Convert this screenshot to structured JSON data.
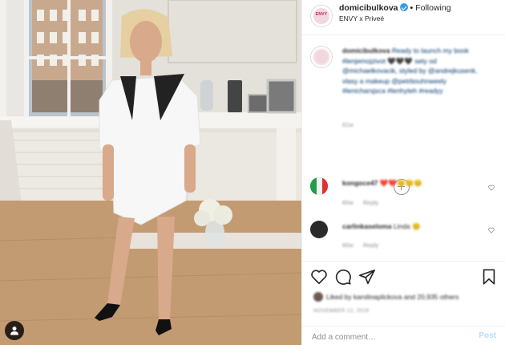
{
  "post": {
    "author": "domicibulkova",
    "follow_label": "Following",
    "location": "ENVY x Priveé",
    "avatar_text": "ENVY"
  },
  "caption": {
    "user": "domicibulkova",
    "text": "Ready to launch my book #lenjemojzivot 🖤🖤🖤 sety od @michaelkovacik, styled by @andrejkusenk, vlasy a makeup @petrbouhnweely #lenicharsjsca #lenhyteh #readyy",
    "time": "61w"
  },
  "comments": [
    {
      "user": "kongoce47",
      "text": "❤️❤️😊😊😊",
      "time": "60w",
      "reply_label": "Reply",
      "avatar_color": "#2e8b57"
    },
    {
      "user": "carlinkaseloma",
      "text": "Linda 😊",
      "time": "60w",
      "reply_label": "Reply",
      "avatar_color": "#2b2b2b"
    }
  ],
  "actions": {
    "likes_text": "Liked by karolinaplickova and 20,935 others",
    "date": "NOVEMBER 12, 2019",
    "comment_placeholder": "Add a comment…",
    "post_label": "Post"
  },
  "icons": {
    "like": "heart-icon",
    "comment": "comment-icon",
    "share": "share-icon",
    "save": "bookmark-icon",
    "tagged_user": "user-icon"
  },
  "colors": {
    "verified": "#3897f0",
    "post_button_disabled": "#b2dffc",
    "link": "#00376b",
    "secondary_text": "#8e8e8e"
  }
}
